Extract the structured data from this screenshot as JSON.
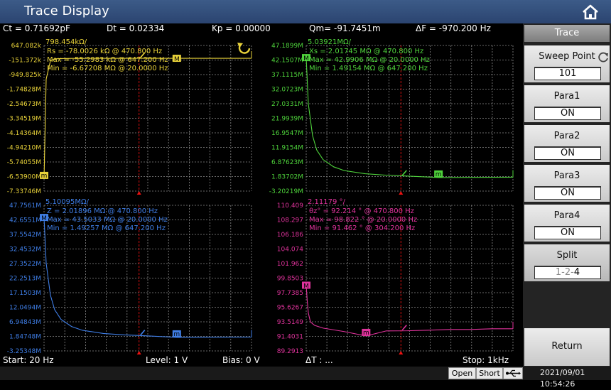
{
  "title": "Trace Display",
  "info": {
    "ct": "Ct =  0.71692pF",
    "dt": "Dt =  0.02334",
    "kp": "Kp =  0.00000",
    "qm": "Qm= -91.7451m",
    "df": "ΔF = -970.200 Hz"
  },
  "panel": {
    "header": "Trace",
    "sweep_points_label": "Sweep Point",
    "sweep_points_value": "101",
    "para1_label": "Para1",
    "para1_value": "ON",
    "para2_label": "Para2",
    "para2_value": "ON",
    "para3_label": "Para3",
    "para3_value": "ON",
    "para4_label": "Para4",
    "para4_value": "ON",
    "split_label": "Split",
    "split_value_a": "1-2-",
    "split_value_b": "4",
    "return_label": "Return"
  },
  "bottom": {
    "start": "Start:  20 Hz",
    "level": "Level:  1 V",
    "bias": "Bias:  0 V",
    "dt": "ΔT : ...",
    "stop": "Stop:  1kHz"
  },
  "status": {
    "open": "Open",
    "short": "Short",
    "datetime": "2021/09/01 10:54:26"
  },
  "colors": {
    "rs": "#e8d23a",
    "xs": "#4fd43c",
    "z": "#3f7ee6",
    "theta": "#e0339c",
    "grid": "#8a8a8a",
    "cursor": "#e11"
  },
  "chart_data": [
    {
      "type": "line",
      "series": [
        {
          "name": "Rs",
          "unit": "kΩ"
        }
      ],
      "ref": "798.454kΩ/",
      "ticks": [
        "647.082k",
        "-151.372k",
        "-949.825k",
        "-1.74828M",
        "-2.54673M",
        "-3.34519M",
        "-4.14364M",
        "-4.94210M",
        "-5.74055M",
        "-6.53900M",
        "-7.33746M"
      ],
      "readout": [
        "Rs    = -78.0026  kΩ @  470.800   Hz",
        "Max  = -55.2983   kΩ @  647.200  Hz",
        "Min   = -6.67208  MΩ @  20.0000   Hz"
      ],
      "marker_label": "M",
      "min_marker_label": "m",
      "x": [
        20,
        30,
        50,
        70,
        100,
        150,
        200,
        300,
        400,
        500,
        647,
        800,
        1000
      ],
      "y": [
        -6672080,
        -1200000,
        -200000,
        -90000,
        -70000,
        -62000,
        -60000,
        -58000,
        -57000,
        -56500,
        -55298,
        -55500,
        -56000
      ]
    },
    {
      "type": "line",
      "series": [
        {
          "name": "Xs",
          "unit": "MΩ"
        }
      ],
      "ref": "5.03921MΩ/",
      "ticks": [
        "47.1899M",
        "42.1507M",
        "37.1115M",
        "32.0723M",
        "27.0331M",
        "21.9939M",
        "16.9547M",
        "11.9154M",
        "6.87623M",
        "1.83702M",
        "-3.20219M"
      ],
      "readout": [
        "Xs     =  2.01745  MΩ @  470.800   Hz",
        "Max  =  42.9906  MΩ @  20.0000   Hz",
        "Min   =  1.49154  MΩ @  647.200   Hz"
      ],
      "marker_label": "M",
      "min_marker_label": "m",
      "x": [
        20,
        30,
        50,
        70,
        100,
        150,
        200,
        300,
        400,
        500,
        647,
        800,
        1000
      ],
      "y": [
        42990600,
        27000000,
        16000000,
        11000000,
        7700000,
        5200000,
        3900000,
        2800000,
        2300000,
        2000000,
        1491540,
        1550000,
        1600000
      ]
    },
    {
      "type": "line",
      "series": [
        {
          "name": "Z",
          "unit": "MΩ"
        }
      ],
      "ref": "5.10095MΩ/",
      "ticks": [
        "47.7561M",
        "42.6551M",
        "37.5542M",
        "32.4532M",
        "27.3522M",
        "22.2513M",
        "17.1503M",
        "12.0494M",
        "6.94843M",
        "1.84748M",
        "-3.25348M"
      ],
      "readout": [
        "Z       =  2.01896  MΩ @  470.800   Hz",
        "Max  =  43.5033  MΩ @  20.0000   Hz",
        "Min   =  1.49257  MΩ @  647.200   Hz"
      ],
      "marker_label": "M",
      "min_marker_label": "m",
      "x": [
        20,
        30,
        50,
        70,
        100,
        150,
        200,
        300,
        400,
        500,
        647,
        800,
        1000
      ],
      "y": [
        43503300,
        27500000,
        16300000,
        11200000,
        7800000,
        5300000,
        4000000,
        2850000,
        2350000,
        2050000,
        1492570,
        1550000,
        1600000
      ]
    },
    {
      "type": "line",
      "series": [
        {
          "name": "θz°",
          "unit": "°"
        }
      ],
      "ref": "2.11179 °/",
      "ticks": [
        "110.409",
        "108.297",
        "106.186",
        "104.074",
        "101.962",
        "99.8503",
        "97.7385",
        "95.6267",
        "93.5149",
        "91.4031",
        "89.2913"
      ],
      "readout": [
        "θz°    =  92.214     ° @  470.800   Hz",
        "Max  =  98.822     ° @  20.0000   Hz",
        "Min   =  91.462     ° @  304.200   Hz"
      ],
      "marker_label": "M",
      "min_marker_label": "m",
      "x": [
        20,
        25,
        30,
        40,
        60,
        100,
        200,
        304,
        400,
        500,
        600,
        700,
        800,
        900,
        1000
      ],
      "y": [
        98.822,
        96.5,
        94.8,
        93.5,
        93.0,
        92.6,
        92.1,
        91.462,
        92.2,
        92.214,
        92.3,
        92.4,
        92.4,
        92.5,
        92.5
      ]
    }
  ]
}
